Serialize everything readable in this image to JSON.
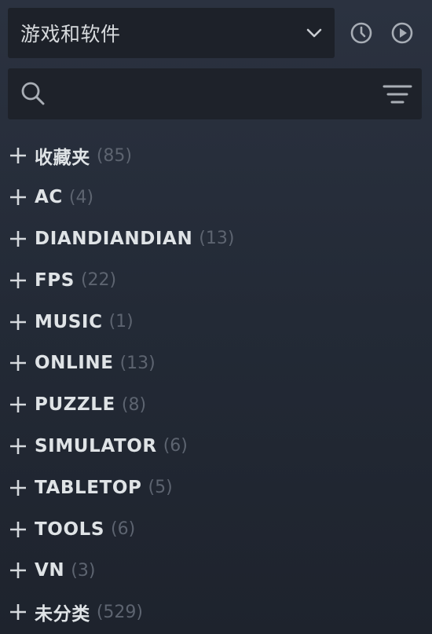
{
  "header": {
    "filter_label": "游戏和软件",
    "icons": {
      "dropdown": "chevron-down-icon",
      "recent": "clock-icon",
      "play": "play-icon"
    }
  },
  "search": {
    "placeholder": "",
    "value": "",
    "icons": {
      "search": "search-icon",
      "filter": "filter-lines-icon"
    }
  },
  "collections": [
    {
      "name": "收藏夹",
      "count": "(85)"
    },
    {
      "name": "AC",
      "count": "(4)"
    },
    {
      "name": "DIANDIANDIAN",
      "count": "(13)"
    },
    {
      "name": "FPS",
      "count": "(22)"
    },
    {
      "name": "MUSIC",
      "count": "(1)"
    },
    {
      "name": "ONLINE",
      "count": "(13)"
    },
    {
      "name": "PUZZLE",
      "count": "(8)"
    },
    {
      "name": "SIMULATOR",
      "count": "(6)"
    },
    {
      "name": "TABLETOP",
      "count": "(5)"
    },
    {
      "name": "TOOLS",
      "count": "(6)"
    },
    {
      "name": "VN",
      "count": "(3)"
    },
    {
      "name": "未分类",
      "count": "(529)"
    }
  ],
  "colors": {
    "panel_bg": "#2b3240",
    "field_bg": "#1e222a",
    "text": "#dfe3e6",
    "count_text": "#5d6470",
    "icon": "#aab0b8"
  }
}
